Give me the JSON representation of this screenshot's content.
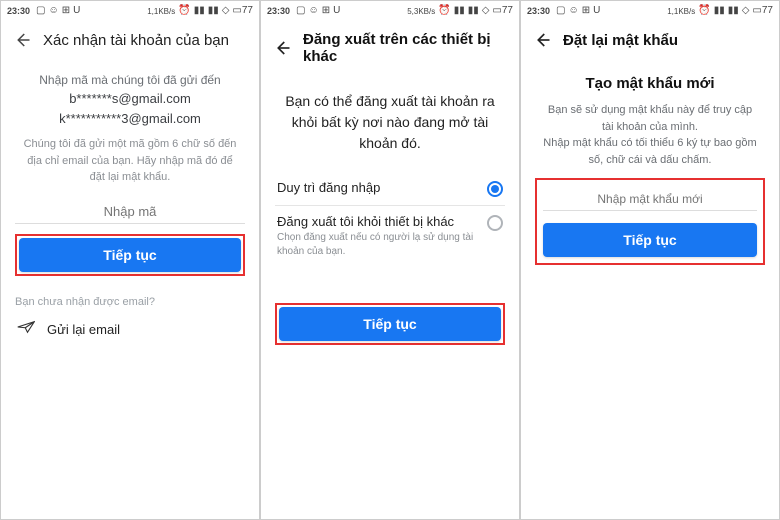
{
  "statusbar": {
    "time": "23:30",
    "speed1": "1,1KB/s",
    "speed2": "5,3KB/s",
    "speed3": "1,1KB/s",
    "battery": "77"
  },
  "screen1": {
    "header": "Xác nhận tài khoản của bạn",
    "intro": "Nhập mã mà chúng tôi đã gửi đến",
    "email1": "b*******s@gmail.com",
    "email2": "k***********3@gmail.com",
    "desc": "Chúng tôi đã gửi một mã gồm 6 chữ số đến địa chỉ email của bạn. Hãy nhập mã đó để đặt lại mật khẩu.",
    "code_placeholder": "Nhập mã",
    "continue": "Tiếp tục",
    "not_received": "Bạn chưa nhận được email?",
    "resend": "Gửi lại email"
  },
  "screen2": {
    "header": "Đăng xuất trên các thiết bị khác",
    "headline": "Bạn có thể đăng xuất tài khoản ra khỏi bất kỳ nơi nào đang mở tài khoản đó.",
    "option1": "Duy trì đăng nhập",
    "option2_title": "Đăng xuất tôi khỏi thiết bị khác",
    "option2_sub": "Chọn đăng xuất nếu có người lạ sử dụng tài khoản của bạn.",
    "continue": "Tiếp tục"
  },
  "screen3": {
    "header": "Đặt lại mật khẩu",
    "title": "Tạo mật khẩu mới",
    "desc": "Bạn sẽ sử dụng mật khẩu này để truy cập tài khoản của mình.\nNhập mật khẩu có tối thiểu 6 ký tự bao gồm số, chữ cái và dấu chấm.",
    "pass_placeholder": "Nhập mật khẩu mới",
    "continue": "Tiếp tục"
  }
}
